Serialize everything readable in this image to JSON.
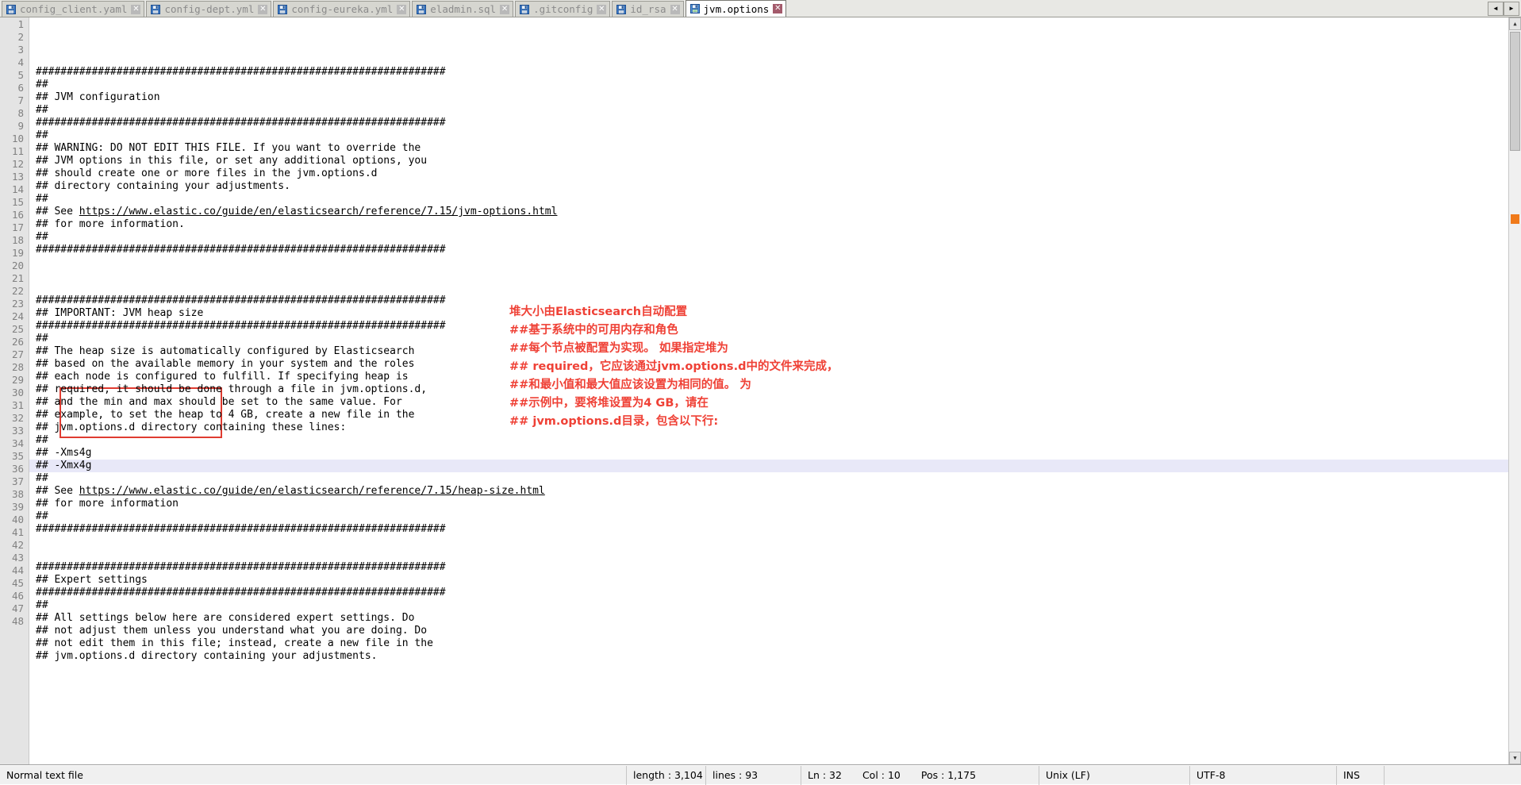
{
  "window": {
    "tab_nav": {
      "left_label": "◄",
      "right_label": "►"
    }
  },
  "tabs": [
    {
      "label": "config_client.yaml",
      "icon": "floppy-disk-icon",
      "close": "✕",
      "active": false
    },
    {
      "label": "config-dept.yml",
      "icon": "floppy-disk-icon",
      "close": "✕",
      "active": false
    },
    {
      "label": "config-eureka.yml",
      "icon": "floppy-disk-icon",
      "close": "✕",
      "active": false
    },
    {
      "label": "eladmin.sql",
      "icon": "floppy-disk-icon",
      "close": "✕",
      "active": false
    },
    {
      "label": ".gitconfig",
      "icon": "floppy-disk-icon",
      "close": "✕",
      "active": false
    },
    {
      "label": "id_rsa",
      "icon": "floppy-disk-icon",
      "close": "✕",
      "active": false
    },
    {
      "label": "jvm.options",
      "icon": "floppy-disk-icon",
      "close": "✕",
      "active": true
    }
  ],
  "editor": {
    "current_line": 32,
    "hash_rule": "##################################################################",
    "lines": [
      "##################################################################",
      "##",
      "## JVM configuration",
      "##",
      "##################################################################",
      "##",
      "## WARNING: DO NOT EDIT THIS FILE. If you want to override the",
      "## JVM options in this file, or set any additional options, you",
      "## should create one or more files in the jvm.options.d",
      "## directory containing your adjustments.",
      "##",
      "## See https://www.elastic.co/guide/en/elasticsearch/reference/7.15/jvm-options.html",
      "## for more information.",
      "##",
      "##################################################################",
      "",
      "",
      "",
      "##################################################################",
      "## IMPORTANT: JVM heap size",
      "##################################################################",
      "##",
      "## The heap size is automatically configured by Elasticsearch",
      "## based on the available memory in your system and the roles",
      "## each node is configured to fulfill. If specifying heap is",
      "## required, it should be done through a file in jvm.options.d,",
      "## and the min and max should be set to the same value. For",
      "## example, to set the heap to 4 GB, create a new file in the",
      "## jvm.options.d directory containing these lines:",
      "##",
      "## -Xms4g",
      "## -Xmx4g",
      "##",
      "## See https://www.elastic.co/guide/en/elasticsearch/reference/7.15/heap-size.html",
      "## for more information",
      "##",
      "##################################################################",
      "",
      "",
      "##################################################################",
      "## Expert settings",
      "##################################################################",
      "##",
      "## All settings below here are considered expert settings. Do",
      "## not adjust them unless you understand what you are doing. Do",
      "## not edit them in this file; instead, create a new file in the",
      "## jvm.options.d directory containing your adjustments."
    ],
    "link_lines": {
      "12": {
        "prefix": "## See ",
        "url": "https://www.elastic.co/guide/en/elasticsearch/reference/7.15/jvm-options.html",
        "suffix": ""
      },
      "34": {
        "prefix": "## See ",
        "url": "https://www.elastic.co/guide/en/elasticsearch/reference/7.15/heap-size.html",
        "suffix": ""
      }
    }
  },
  "annotation": {
    "color": "#ef4136",
    "lines": [
      "堆大小由Elasticsearch自动配置",
      "##基于系统中的可用内存和角色",
      "##每个节点被配置为实现。 如果指定堆为",
      "## required，它应该通过jvm.options.d中的文件来完成，",
      "##和最小值和最大值应该设置为相同的值。 为",
      "##示例中，要将堆设置为4 GB，请在",
      "## jvm.options.d目录，包含以下行:"
    ]
  },
  "highlight_box": {
    "color": "#e03c31",
    "from_line": 30,
    "to_line": 33
  },
  "scrollbar": {
    "up_arrow": "▲",
    "down_arrow": "▼",
    "marker_color": "#f07a1a"
  },
  "statusbar": {
    "file_type": "Normal text file",
    "length_label": "length : 3,104",
    "lines_label": "lines : 93",
    "ln": "Ln : 32",
    "col": "Col : 10",
    "pos": "Pos : 1,175",
    "eol": "Unix (LF)",
    "encoding": "UTF-8",
    "insert_mode": "INS"
  }
}
